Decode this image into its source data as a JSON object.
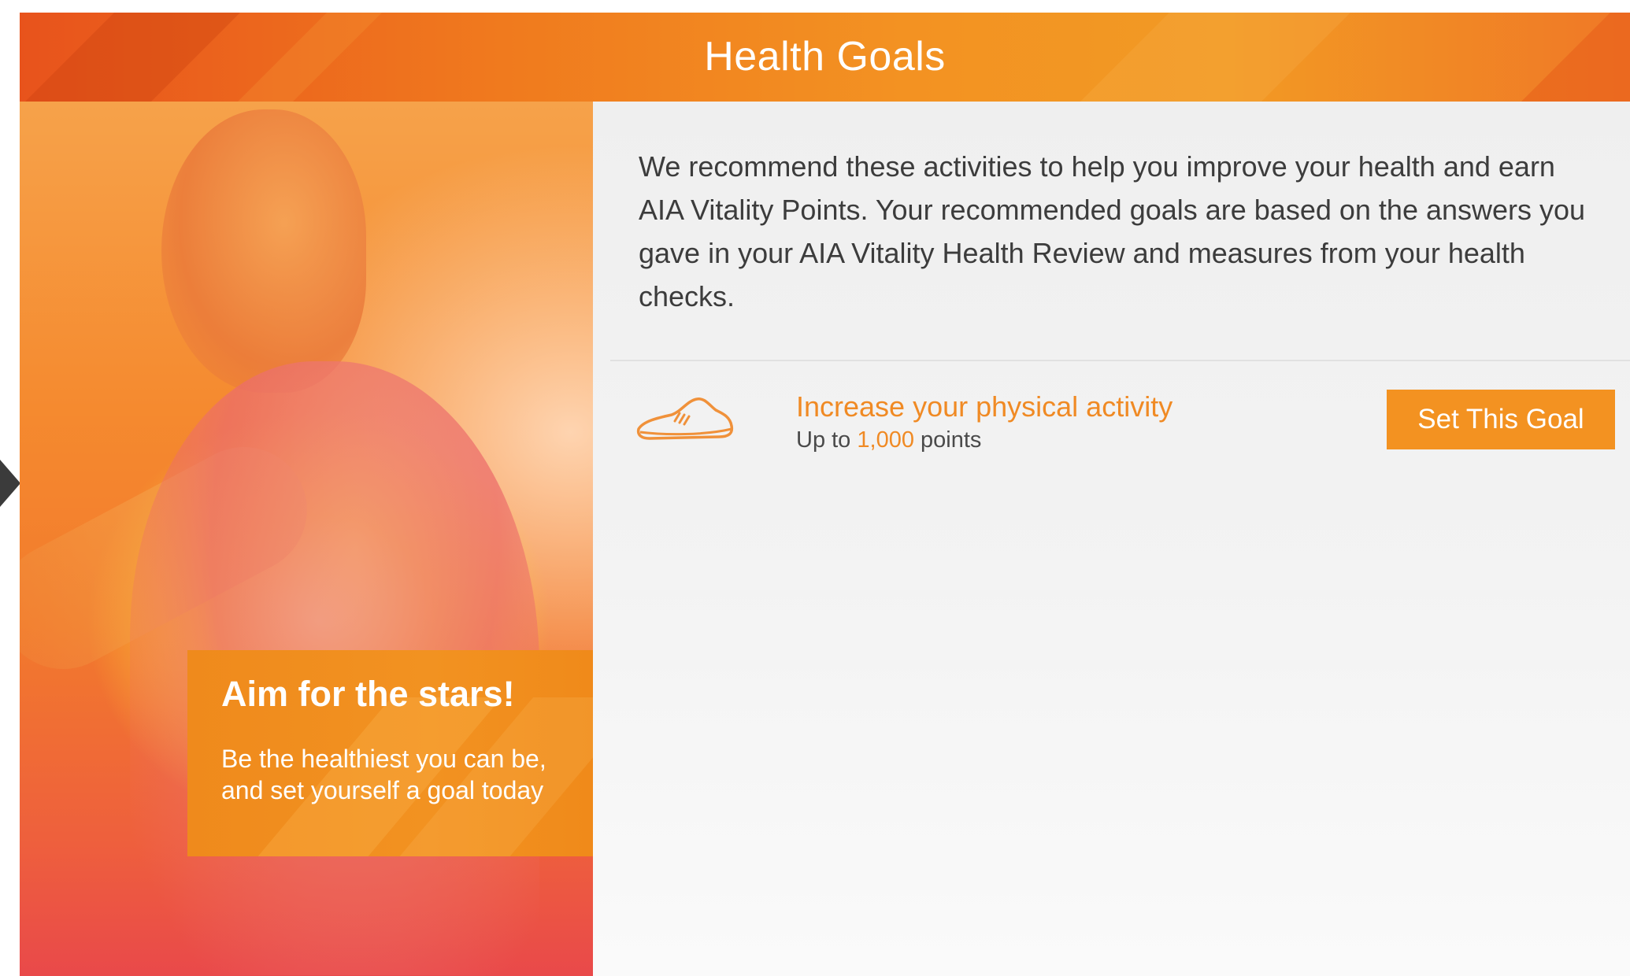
{
  "header": {
    "title": "Health Goals"
  },
  "promo": {
    "title": "Aim for the stars!",
    "text": "Be the healthiest you can be, and set yourself a goal today"
  },
  "intro": {
    "text": "We recommend these activities to help you improve your health and earn AIA Vitality Points. Your recommended goals are based on the answers you gave in your AIA Vitality Health Review and measures from your health checks."
  },
  "goal": {
    "icon": "sneaker-icon",
    "title": "Increase your physical activity",
    "points_prefix": "Up to",
    "points_value": "1,000",
    "points_suffix": "points",
    "button_label": "Set This Goal"
  },
  "colors": {
    "accent": "#f39221",
    "accent_text": "#f08a24",
    "body_text": "#3c3c3c"
  }
}
